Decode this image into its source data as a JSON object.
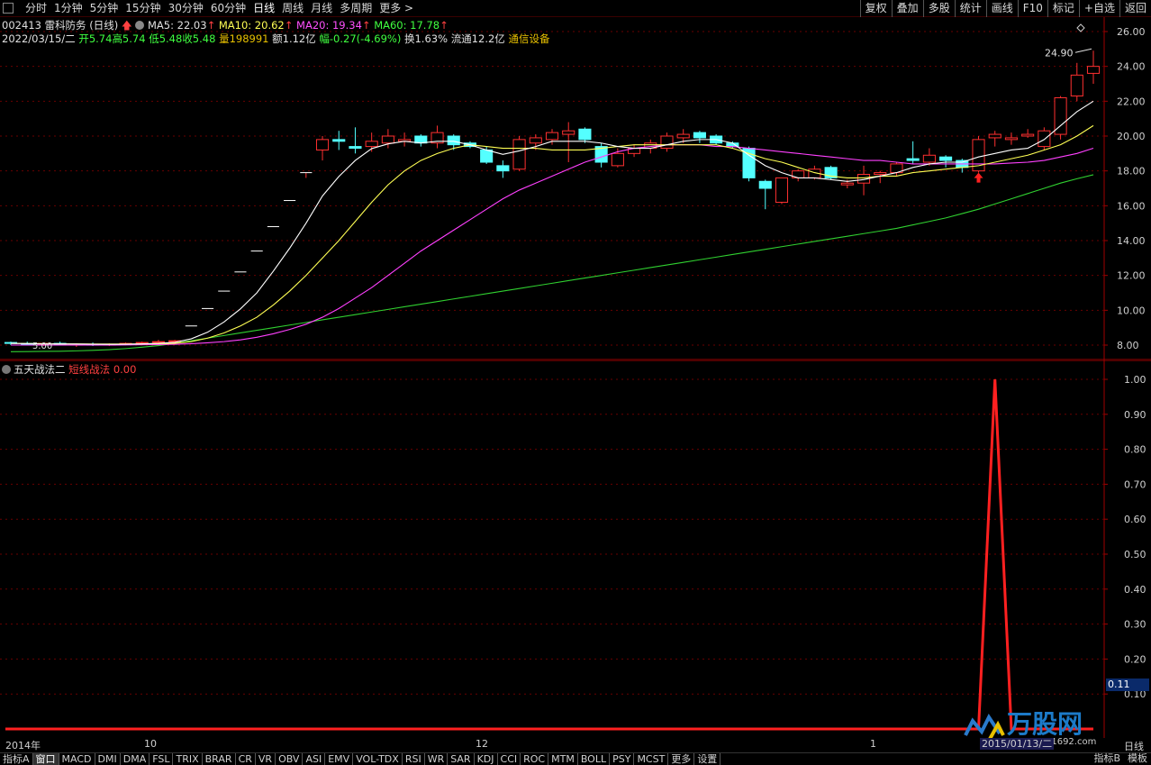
{
  "toolbar": {
    "tabs": [
      "分时",
      "1分钟",
      "5分钟",
      "15分钟",
      "30分钟",
      "60分钟",
      "日线",
      "周线",
      "月线",
      "多周期",
      "更多 >"
    ],
    "active_tab": "日线",
    "right_buttons": [
      "复权",
      "叠加",
      "多股",
      "统计",
      "画线",
      "F10",
      "标记",
      "+自选",
      "返回"
    ]
  },
  "stock": {
    "code": "002413",
    "name": "雷科防务",
    "period": "(日线)",
    "ma5": "MA5: 22.03",
    "ma10": "MA10: 20.62",
    "ma20": "MA20: 19.34",
    "ma60": "MA60: 17.78",
    "date": "2022/03/15/二",
    "open": "开5.74",
    "high": "高5.74",
    "low": "低5.48",
    "close": "收5.48",
    "volume": "量198991",
    "amount": "额1.12亿",
    "change": "幅-0.27(-4.69%)",
    "turnover": "换1.63%",
    "float_cap": "流通12.2亿",
    "sector": "通信设备",
    "max_label": "24.90",
    "min_label": "5.00"
  },
  "indicator": {
    "name": "五天战法二",
    "line_name": "短线战法",
    "line_value": "0.00",
    "current_tag": "0.11"
  },
  "xaxis": {
    "labels": [
      "2014年",
      "10",
      "12",
      "1"
    ],
    "tip_date": "2015/01/13/二",
    "period": "日线"
  },
  "bottom_tabs": [
    "指标A",
    "窗口",
    "MACD",
    "DMI",
    "DMA",
    "FSL",
    "TRIX",
    "BRAR",
    "CR",
    "VR",
    "OBV",
    "ASI",
    "EMV",
    "VOL-TDX",
    "RSI",
    "WR",
    "SAR",
    "KDJ",
    "CCI",
    "ROC",
    "MTM",
    "BOLL",
    "PSY",
    "MCST",
    "更多",
    "设置"
  ],
  "bottom_right_tabs": [
    "指标B",
    "模板"
  ],
  "watermark": {
    "text": "万股网",
    "url": "www.2w1692.com"
  },
  "colors": {
    "up": "#ff3030",
    "down": "#54ffff",
    "ma5": "#ffffff",
    "ma10": "#ffff54",
    "ma20": "#ff40ff",
    "ma60": "#30d030",
    "grid": "#6a0000",
    "indicator_line": "#ff2020"
  },
  "chart_data": [
    {
      "type": "candlestick",
      "title": "002413 雷科防务 (日线)",
      "yaxis_ticks": [
        8.0,
        10.0,
        12.0,
        14.0,
        16.0,
        18.0,
        20.0,
        22.0,
        24.0,
        26.0
      ],
      "ylim": [
        7.4,
        26.3
      ],
      "candles": [
        {
          "o": 8.15,
          "h": 8.2,
          "l": 8.0,
          "c": 8.1
        },
        {
          "o": 8.1,
          "h": 8.2,
          "l": 8.0,
          "c": 8.05
        },
        {
          "o": 8.05,
          "h": 8.15,
          "l": 7.95,
          "c": 8.1
        },
        {
          "o": 8.1,
          "h": 8.2,
          "l": 8.0,
          "c": 8.0
        },
        {
          "o": 8.0,
          "h": 8.1,
          "l": 7.9,
          "c": 8.05
        },
        {
          "o": 8.05,
          "h": 8.15,
          "l": 7.95,
          "c": 8.0
        },
        {
          "o": 8.0,
          "h": 8.1,
          "l": 7.95,
          "c": 8.05
        },
        {
          "o": 8.05,
          "h": 8.15,
          "l": 8.0,
          "c": 8.1
        },
        {
          "o": 8.1,
          "h": 8.2,
          "l": 8.05,
          "c": 8.15
        },
        {
          "o": 8.15,
          "h": 8.3,
          "l": 8.1,
          "c": 8.2
        },
        {
          "o": 8.2,
          "h": 8.3,
          "l": 8.15,
          "c": 8.25
        },
        {
          "o": 9.1,
          "h": 9.1,
          "l": 9.1,
          "c": 9.1
        },
        {
          "o": 10.1,
          "h": 10.1,
          "l": 10.1,
          "c": 10.1
        },
        {
          "o": 11.1,
          "h": 11.1,
          "l": 11.1,
          "c": 11.1
        },
        {
          "o": 12.2,
          "h": 12.2,
          "l": 12.2,
          "c": 12.2
        },
        {
          "o": 13.4,
          "h": 13.4,
          "l": 13.4,
          "c": 13.4
        },
        {
          "o": 14.8,
          "h": 14.8,
          "l": 14.8,
          "c": 14.8
        },
        {
          "o": 16.3,
          "h": 16.3,
          "l": 16.3,
          "c": 16.3
        },
        {
          "o": 17.9,
          "h": 17.9,
          "l": 17.6,
          "c": 17.9
        },
        {
          "o": 19.2,
          "h": 20.0,
          "l": 18.6,
          "c": 19.8
        },
        {
          "o": 19.8,
          "h": 20.3,
          "l": 19.2,
          "c": 19.7
        },
        {
          "o": 19.4,
          "h": 20.5,
          "l": 19.0,
          "c": 19.3
        },
        {
          "o": 19.4,
          "h": 20.2,
          "l": 19.1,
          "c": 19.7
        },
        {
          "o": 19.6,
          "h": 20.4,
          "l": 19.3,
          "c": 20.0
        },
        {
          "o": 19.7,
          "h": 20.2,
          "l": 19.4,
          "c": 19.8
        },
        {
          "o": 20.0,
          "h": 20.1,
          "l": 19.4,
          "c": 19.6
        },
        {
          "o": 19.6,
          "h": 20.6,
          "l": 19.3,
          "c": 20.2
        },
        {
          "o": 20.0,
          "h": 20.1,
          "l": 19.2,
          "c": 19.5
        },
        {
          "o": 19.6,
          "h": 19.7,
          "l": 19.3,
          "c": 19.4
        },
        {
          "o": 19.2,
          "h": 19.4,
          "l": 18.4,
          "c": 18.5
        },
        {
          "o": 18.3,
          "h": 18.6,
          "l": 17.6,
          "c": 18.0
        },
        {
          "o": 18.1,
          "h": 20.0,
          "l": 18.0,
          "c": 19.8
        },
        {
          "o": 19.6,
          "h": 20.1,
          "l": 19.2,
          "c": 19.9
        },
        {
          "o": 19.8,
          "h": 20.4,
          "l": 19.5,
          "c": 20.2
        },
        {
          "o": 20.1,
          "h": 20.8,
          "l": 18.5,
          "c": 20.3
        },
        {
          "o": 20.4,
          "h": 20.5,
          "l": 19.6,
          "c": 19.8
        },
        {
          "o": 19.4,
          "h": 19.6,
          "l": 18.2,
          "c": 18.5
        },
        {
          "o": 18.3,
          "h": 19.3,
          "l": 18.2,
          "c": 19.0
        },
        {
          "o": 19.0,
          "h": 19.5,
          "l": 18.8,
          "c": 19.3
        },
        {
          "o": 19.3,
          "h": 19.8,
          "l": 19.0,
          "c": 19.6
        },
        {
          "o": 19.3,
          "h": 20.2,
          "l": 19.1,
          "c": 20.0
        },
        {
          "o": 19.9,
          "h": 20.4,
          "l": 19.6,
          "c": 20.1
        },
        {
          "o": 20.2,
          "h": 20.3,
          "l": 19.6,
          "c": 19.9
        },
        {
          "o": 20.0,
          "h": 20.1,
          "l": 19.5,
          "c": 19.6
        },
        {
          "o": 19.6,
          "h": 19.7,
          "l": 19.3,
          "c": 19.4
        },
        {
          "o": 19.3,
          "h": 19.4,
          "l": 17.4,
          "c": 17.6
        },
        {
          "o": 17.4,
          "h": 17.5,
          "l": 15.8,
          "c": 17.0
        },
        {
          "o": 16.2,
          "h": 17.6,
          "l": 16.1,
          "c": 17.6
        },
        {
          "o": 17.6,
          "h": 18.1,
          "l": 17.4,
          "c": 18.0
        },
        {
          "o": 17.6,
          "h": 18.3,
          "l": 17.5,
          "c": 18.1
        },
        {
          "o": 18.2,
          "h": 18.3,
          "l": 17.5,
          "c": 17.6
        },
        {
          "o": 17.2,
          "h": 17.5,
          "l": 17.0,
          "c": 17.3
        },
        {
          "o": 17.3,
          "h": 18.3,
          "l": 16.6,
          "c": 17.8
        },
        {
          "o": 17.8,
          "h": 18.0,
          "l": 17.3,
          "c": 17.9
        },
        {
          "o": 17.9,
          "h": 18.5,
          "l": 17.7,
          "c": 18.4
        },
        {
          "o": 18.7,
          "h": 19.7,
          "l": 18.4,
          "c": 18.6
        },
        {
          "o": 18.5,
          "h": 19.3,
          "l": 18.3,
          "c": 18.9
        },
        {
          "o": 18.8,
          "h": 18.9,
          "l": 18.2,
          "c": 18.6
        },
        {
          "o": 18.6,
          "h": 18.7,
          "l": 17.9,
          "c": 18.2
        },
        {
          "o": 18.0,
          "h": 20.0,
          "l": 17.9,
          "c": 19.8
        },
        {
          "o": 19.9,
          "h": 20.3,
          "l": 19.4,
          "c": 20.1
        },
        {
          "o": 19.8,
          "h": 20.2,
          "l": 19.5,
          "c": 19.9
        },
        {
          "o": 20.0,
          "h": 20.4,
          "l": 19.9,
          "c": 20.1
        },
        {
          "o": 19.4,
          "h": 20.5,
          "l": 19.2,
          "c": 20.3
        },
        {
          "o": 20.1,
          "h": 22.3,
          "l": 19.8,
          "c": 22.2
        },
        {
          "o": 22.3,
          "h": 24.2,
          "l": 22.0,
          "c": 23.5
        },
        {
          "o": 23.6,
          "h": 24.9,
          "l": 23.0,
          "c": 24.0
        }
      ],
      "ma5": [
        8.1,
        8.08,
        8.07,
        8.07,
        8.06,
        8.05,
        8.04,
        8.05,
        8.07,
        8.1,
        8.16,
        8.36,
        8.74,
        9.33,
        10.08,
        11.0,
        12.24,
        13.56,
        15.0,
        16.56,
        17.68,
        18.6,
        19.28,
        19.55,
        19.7,
        19.6,
        19.7,
        19.7,
        19.5,
        19.2,
        18.95,
        19.15,
        19.4,
        19.7,
        19.7,
        19.7,
        19.6,
        19.4,
        19.3,
        19.3,
        19.5,
        19.7,
        19.8,
        19.8,
        19.6,
        18.9,
        18.3,
        17.9,
        17.6,
        17.6,
        17.5,
        17.4,
        17.5,
        17.7,
        17.9,
        18.2,
        18.4,
        18.5,
        18.5,
        18.8,
        19.0,
        19.2,
        19.3,
        19.8,
        20.6,
        21.4,
        22.0
      ],
      "ma10": [
        8.1,
        8.09,
        8.08,
        8.07,
        8.07,
        8.06,
        8.06,
        8.06,
        8.07,
        8.08,
        8.1,
        8.2,
        8.4,
        8.7,
        9.1,
        9.6,
        10.3,
        11.1,
        12.0,
        13.0,
        14.0,
        15.1,
        16.2,
        17.2,
        18.0,
        18.6,
        19.0,
        19.3,
        19.5,
        19.4,
        19.3,
        19.3,
        19.3,
        19.2,
        19.2,
        19.2,
        19.3,
        19.4,
        19.5,
        19.5,
        19.5,
        19.5,
        19.5,
        19.5,
        19.3,
        19.0,
        18.7,
        18.5,
        18.2,
        17.9,
        17.7,
        17.6,
        17.6,
        17.7,
        17.7,
        17.9,
        18.0,
        18.1,
        18.2,
        18.3,
        18.5,
        18.7,
        18.9,
        19.2,
        19.5,
        20.0,
        20.6
      ],
      "ma20": [
        8.0,
        8.0,
        8.0,
        8.0,
        8.0,
        8.0,
        8.0,
        8.01,
        8.02,
        8.03,
        8.05,
        8.08,
        8.13,
        8.2,
        8.3,
        8.45,
        8.65,
        8.9,
        9.2,
        9.6,
        10.1,
        10.7,
        11.3,
        12.0,
        12.7,
        13.4,
        14.0,
        14.6,
        15.2,
        15.8,
        16.4,
        16.9,
        17.3,
        17.7,
        18.1,
        18.5,
        18.8,
        19.1,
        19.3,
        19.4,
        19.5,
        19.5,
        19.5,
        19.4,
        19.4,
        19.3,
        19.2,
        19.1,
        19.0,
        18.9,
        18.8,
        18.7,
        18.6,
        18.6,
        18.5,
        18.4,
        18.4,
        18.4,
        18.4,
        18.4,
        18.4,
        18.45,
        18.5,
        18.6,
        18.8,
        19.0,
        19.3
      ],
      "ma60": [
        7.6,
        7.6,
        7.6,
        7.6,
        7.61,
        7.61,
        7.62,
        7.63,
        7.64,
        7.65,
        7.67,
        7.7,
        7.74,
        7.8,
        7.88,
        7.97,
        8.1,
        8.25,
        8.4,
        8.55,
        8.7,
        8.85,
        9.0,
        9.15,
        9.3,
        9.45,
        9.6,
        9.75,
        9.9,
        10.05,
        10.2,
        10.35,
        10.5,
        10.65,
        10.8,
        10.95,
        11.1,
        11.25,
        11.4,
        11.55,
        11.7,
        11.85,
        12.0,
        12.15,
        12.3,
        12.45,
        12.6,
        12.75,
        12.9,
        13.05,
        13.2,
        13.35,
        13.5,
        13.65,
        13.8,
        13.95,
        14.1,
        14.25,
        14.4,
        14.55,
        14.7,
        14.9,
        15.1,
        15.3,
        15.55,
        15.8,
        16.1,
        16.4,
        16.7,
        17.0,
        17.3,
        17.55,
        17.78
      ]
    },
    {
      "type": "line",
      "title": "五天战法二",
      "yaxis_ticks": [
        0.1,
        0.2,
        0.3,
        0.4,
        0.5,
        0.6,
        0.7,
        0.8,
        0.9,
        1.0
      ],
      "ylim": [
        0,
        1.04
      ],
      "series": [
        {
          "name": "短线战法",
          "values": [
            0,
            0,
            0,
            0,
            0,
            0,
            0,
            0,
            0,
            0,
            0,
            0,
            0,
            0,
            0,
            0,
            0,
            0,
            0,
            0,
            0,
            0,
            0,
            0,
            0,
            0,
            0,
            0,
            0,
            0,
            0,
            0,
            0,
            0,
            0,
            0,
            0,
            0,
            0,
            0,
            0,
            0,
            0,
            0,
            0,
            0,
            0,
            0,
            0,
            0,
            0,
            0,
            0,
            0,
            0,
            0,
            0,
            0,
            0,
            0,
            1,
            0,
            0,
            0,
            0,
            0,
            0
          ]
        }
      ]
    }
  ]
}
